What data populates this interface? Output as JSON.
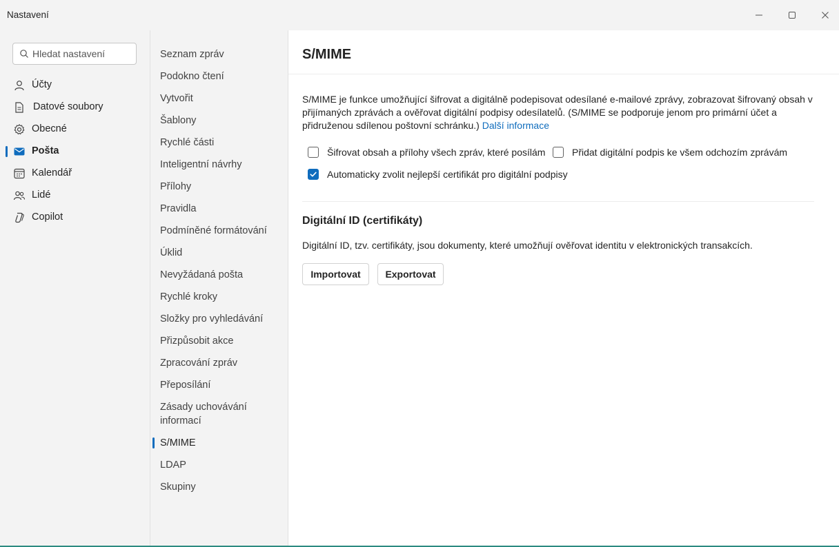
{
  "window": {
    "title": "Nastavení"
  },
  "search": {
    "placeholder": "Hledat nastavení"
  },
  "left_nav": [
    {
      "label": "Účty",
      "icon": "person-icon"
    },
    {
      "label": "Datové soubory",
      "icon": "document-icon"
    },
    {
      "label": "Obecné",
      "icon": "gear-icon"
    },
    {
      "label": "Pošta",
      "icon": "mail-icon",
      "active": true
    },
    {
      "label": "Kalendář",
      "icon": "calendar-icon"
    },
    {
      "label": "Lidé",
      "icon": "people-icon"
    },
    {
      "label": "Copilot",
      "icon": "copilot-icon"
    }
  ],
  "mid_nav": [
    "Seznam zpráv",
    "Podokno čtení",
    "Vytvořit",
    "Šablony",
    "Rychlé části",
    "Inteligentní návrhy",
    "Přílohy",
    "Pravidla",
    "Podmíněné formátování",
    "Úklid",
    "Nevyžádaná pošta",
    "Rychlé kroky",
    "Složky pro vyhledávání",
    "Přizpůsobit akce",
    "Zpracování zpráv",
    "Přeposílání",
    "Zásady uchovávání informací",
    "S/MIME",
    "LDAP",
    "Skupiny"
  ],
  "mid_nav_active": "S/MIME",
  "content": {
    "title": "S/MIME",
    "description": "S/MIME je funkce umožňující šifrovat a digitálně podepisovat odesílané e-mailové zprávy, zobrazovat šifrovaný obsah v přijímaných zprávách a ověřovat digitální podpisy odesílatelů. (S/MIME se podporuje jenom pro primární účet a přidruženou sdílenou poštovní schránku.)",
    "more_info_link": "Další informace",
    "checkboxes": {
      "encrypt": {
        "label": "Šifrovat obsah a přílohy všech zpráv, které posílám",
        "checked": false
      },
      "sign": {
        "label": "Přidat digitální podpis ke všem odchozím zprávám",
        "checked": false
      },
      "auto_cert": {
        "label": "Automaticky zvolit nejlepší certifikát pro digitální podpisy",
        "checked": true
      }
    },
    "digital_id": {
      "title": "Digitální ID (certifikáty)",
      "description": "Digitální ID, tzv. certifikáty, jsou dokumenty, které umožňují ověřovat identitu v elektronických transakcích.",
      "import_label": "Importovat",
      "export_label": "Exportovat"
    }
  },
  "colors": {
    "accent": "#0f6cbd",
    "window_bg": "#f3f3f3",
    "content_bg": "#ffffff"
  }
}
